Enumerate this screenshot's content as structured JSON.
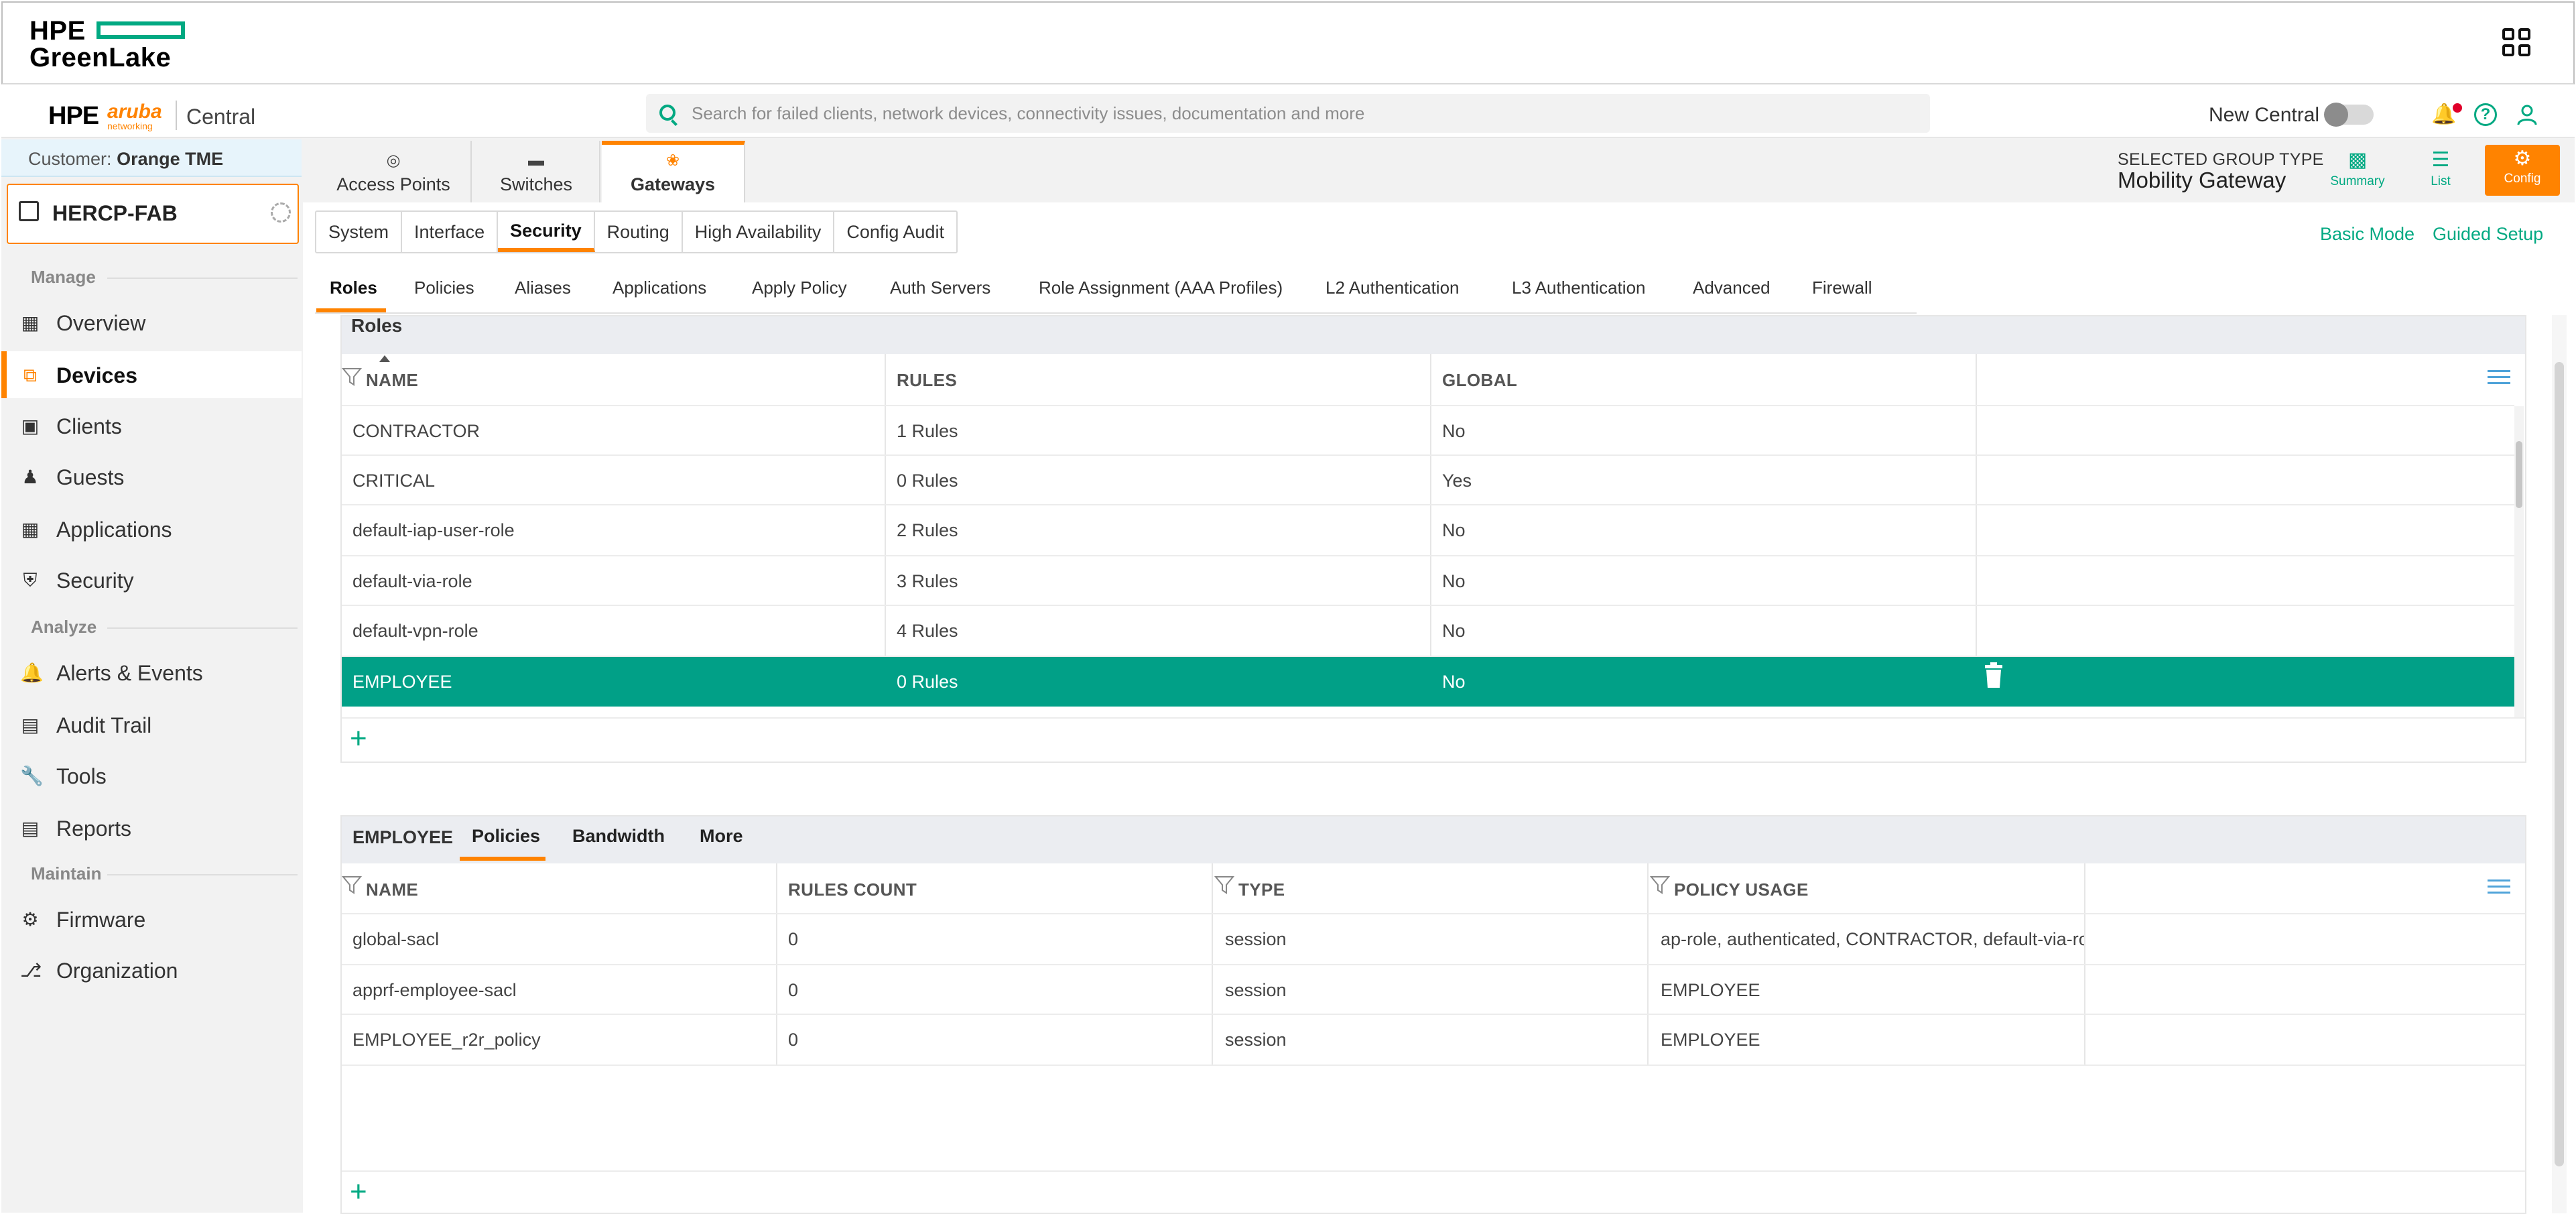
{
  "greenlake": {
    "logo_top": "HPE",
    "logo_bottom": "GreenLake"
  },
  "header": {
    "brand_hpe": "HPE",
    "brand_aruba": "aruba",
    "brand_aruba_sub": "networking",
    "product": "Central",
    "search_placeholder": "Search for failed clients, network devices, connectivity issues, documentation and more",
    "new_central_label": "New Central"
  },
  "sidebar": {
    "customer_label": "Customer:",
    "customer_name": "Orange TME",
    "group_name": "HERCP-FAB",
    "sections": {
      "manage": "Manage",
      "analyze": "Analyze",
      "maintain": "Maintain"
    },
    "items": [
      {
        "label": "Overview",
        "icon": "overview-icon"
      },
      {
        "label": "Devices",
        "icon": "devices-icon",
        "active": true
      },
      {
        "label": "Clients",
        "icon": "clients-icon"
      },
      {
        "label": "Guests",
        "icon": "guests-icon"
      },
      {
        "label": "Applications",
        "icon": "applications-icon"
      },
      {
        "label": "Security",
        "icon": "security-shield-icon"
      },
      {
        "label": "Alerts & Events",
        "icon": "bell-icon"
      },
      {
        "label": "Audit Trail",
        "icon": "audit-trail-icon"
      },
      {
        "label": "Tools",
        "icon": "wrench-icon"
      },
      {
        "label": "Reports",
        "icon": "reports-icon"
      },
      {
        "label": "Firmware",
        "icon": "firmware-icon"
      },
      {
        "label": "Organization",
        "icon": "organization-icon"
      }
    ]
  },
  "device_tabs": [
    {
      "label": "Access Points",
      "icon": "access-point-icon"
    },
    {
      "label": "Switches",
      "icon": "switch-icon"
    },
    {
      "label": "Gateways",
      "icon": "gateway-icon",
      "active": true
    }
  ],
  "group_type": {
    "label": "SELECTED GROUP TYPE",
    "value": "Mobility Gateway"
  },
  "view_buttons": {
    "summary": "Summary",
    "list": "List",
    "config": "Config"
  },
  "config_tabs": [
    "System",
    "Interface",
    "Security",
    "Routing",
    "High Availability",
    "Config Audit"
  ],
  "config_tabs_active": "Security",
  "mode_links": {
    "basic": "Basic Mode",
    "guided": "Guided Setup"
  },
  "security_tabs": [
    "Roles",
    "Policies",
    "Aliases",
    "Applications",
    "Apply Policy",
    "Auth Servers",
    "Role Assignment (AAA Profiles)",
    "L2 Authentication",
    "L3 Authentication",
    "Advanced",
    "Firewall"
  ],
  "roles_table": {
    "title": "Roles",
    "columns": [
      "NAME",
      "RULES",
      "GLOBAL"
    ],
    "rows": [
      {
        "name": "CONTRACTOR",
        "rules": "1 Rules",
        "global": "No"
      },
      {
        "name": "CRITICAL",
        "rules": "0 Rules",
        "global": "Yes"
      },
      {
        "name": "default-iap-user-role",
        "rules": "2 Rules",
        "global": "No"
      },
      {
        "name": "default-via-role",
        "rules": "3 Rules",
        "global": "No"
      },
      {
        "name": "default-vpn-role",
        "rules": "4 Rules",
        "global": "No"
      },
      {
        "name": "EMPLOYEE",
        "rules": "0 Rules",
        "global": "No",
        "selected": true
      }
    ],
    "add_symbol": "+"
  },
  "employee_panel": {
    "title": "EMPLOYEE",
    "tabs": [
      "Policies",
      "Bandwidth",
      "More"
    ],
    "active_tab": "Policies",
    "columns": [
      "NAME",
      "RULES COUNT",
      "TYPE",
      "POLICY USAGE"
    ],
    "rows": [
      {
        "name": "global-sacl",
        "count": "0",
        "type": "session",
        "usage": "ap-role, authenticated, CONTRACTOR, default-via-ro"
      },
      {
        "name": "apprf-employee-sacl",
        "count": "0",
        "type": "session",
        "usage": "EMPLOYEE"
      },
      {
        "name": "EMPLOYEE_r2r_policy",
        "count": "0",
        "type": "session",
        "usage": "EMPLOYEE"
      }
    ],
    "add_symbol": "+"
  },
  "colors": {
    "accent": "#ff8300",
    "teal": "#01a982",
    "selected_row": "#01a087",
    "link_blue": "#4fa3d9"
  }
}
